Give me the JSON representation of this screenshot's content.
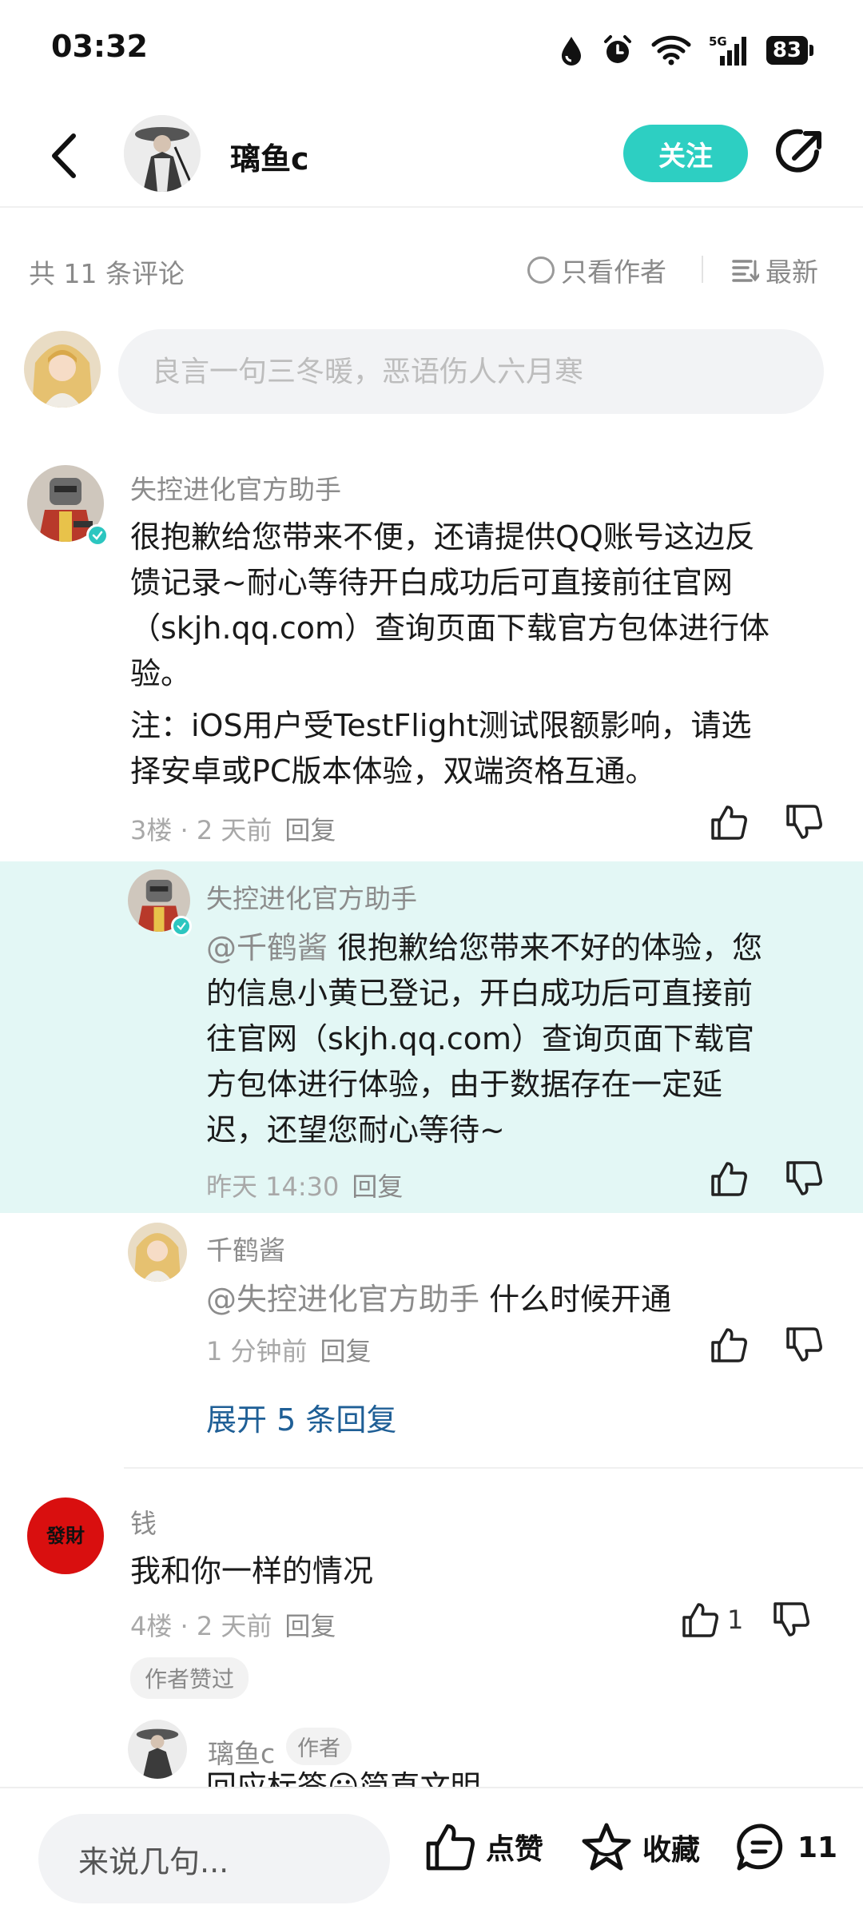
{
  "status_bar": {
    "time": "03:32",
    "battery": "83",
    "icons": [
      "drop-icon",
      "alarm-icon",
      "wifi-icon",
      "signal-5g-icon",
      "battery-icon"
    ]
  },
  "header": {
    "username": "璃鱼c",
    "follow_label": "关注"
  },
  "filter": {
    "count_label": "共 11 条评论",
    "only_author_label": "只看作者",
    "sort_label": "最新"
  },
  "composer": {
    "placeholder": "良言一句三冬暖，恶语伤人六月寒"
  },
  "colors": {
    "accent": "#2dcfc2",
    "highlight_bg": "#e3f7f5",
    "link": "#1f5f96"
  },
  "comments": [
    {
      "author": "失控进化官方助手",
      "text_lines": [
        "很抱歉给您带来不便，还请提供QQ账号这边反",
        "馈记录~耐心等待开白成功后可直接前往官网",
        "（skjh.qq.com）查询页面下载官方包体进行体",
        "验。",
        "注：iOS用户受TestFlight测试限额影响，请选",
        "择安卓或PC版本体验，双端资格互通。"
      ],
      "meta": "3楼 · 2 天前",
      "reply_label": "回复"
    },
    {
      "author": "钱",
      "avatar_text": "發財",
      "text": "我和你一样的情况",
      "meta": "4楼 · 2 天前",
      "reply_label": "回复",
      "likes": "1",
      "tag": "作者赞过"
    }
  ],
  "replies": [
    {
      "author": "失控进化官方助手",
      "mention": "@千鹤酱",
      "text_first": " 很抱歉给您带来不好的体验，您",
      "text_lines": [
        "的信息小黄已登记，开白成功后可直接前",
        "往官网（skjh.qq.com）查询页面下载官",
        "方包体进行体验，由于数据存在一定延",
        "迟，还望您耐心等待~"
      ],
      "meta": "昨天 14:30",
      "reply_label": "回复"
    },
    {
      "author": "千鹤酱",
      "mention": "@失控进化官方助手",
      "text": " 什么时候开通",
      "meta": "1 分钟前",
      "reply_label": "回复"
    },
    {
      "author": "璃鱼c",
      "author_tag": "作者",
      "partial_text": "回应标签😀简直文明"
    }
  ],
  "expand_label": "展开 5 条回复",
  "bottom_bar": {
    "input_placeholder": "来说几句...",
    "like_label": "点赞",
    "favorite_label": "收藏",
    "comment_count": "11"
  }
}
